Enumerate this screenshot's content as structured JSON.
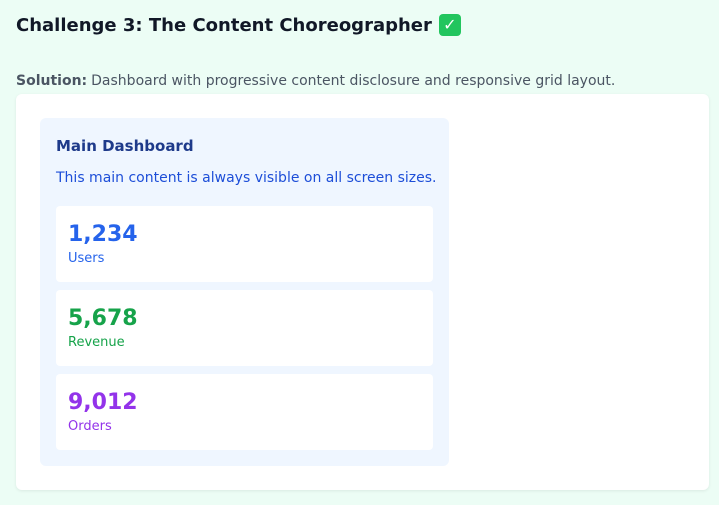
{
  "header": {
    "title": "Challenge 3: The Content Choreographer",
    "status_icon": "check-mark-icon"
  },
  "solution": {
    "prefix": "Solution:",
    "text": "Dashboard with progressive content disclosure and responsive grid layout."
  },
  "dashboard": {
    "title": "Main Dashboard",
    "description": "This main content is always visible on all screen sizes.",
    "stats": [
      {
        "value": "1,234",
        "label": "Users",
        "color": "#2563eb"
      },
      {
        "value": "5,678",
        "label": "Revenue",
        "color": "#16a34a"
      },
      {
        "value": "9,012",
        "label": "Orders",
        "color": "#9333ea"
      }
    ]
  },
  "colors": {
    "page_background": "#ecfdf5",
    "panel_background": "#eff6ff",
    "check_green": "#22c55e"
  }
}
